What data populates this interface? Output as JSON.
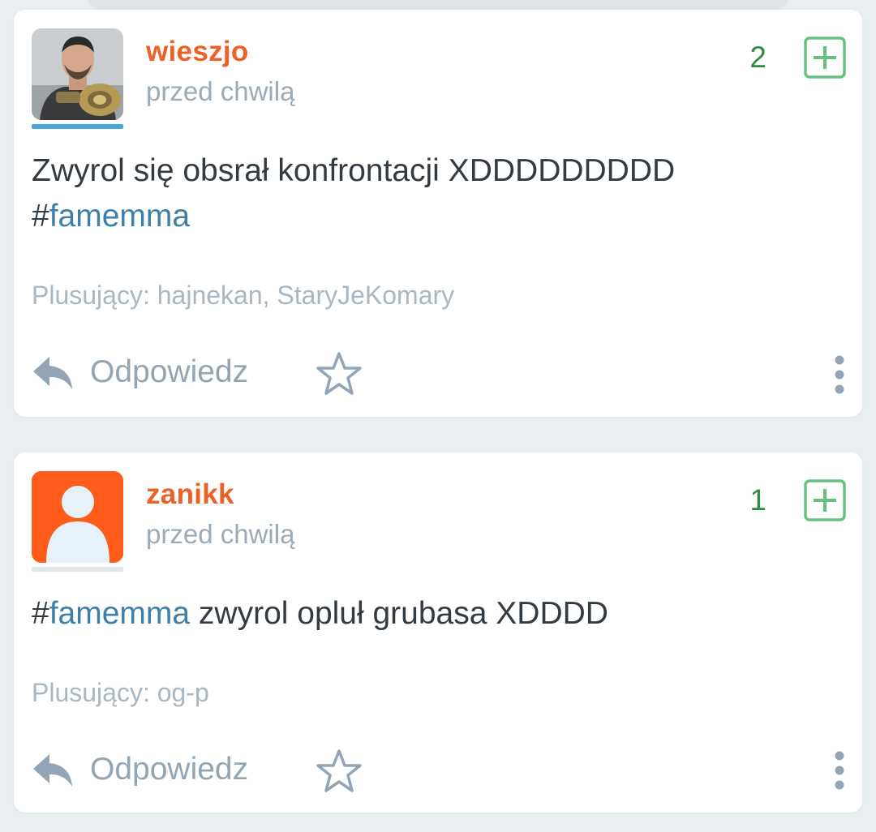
{
  "entries": [
    {
      "username": "wieszjo",
      "time": "przed chwilą",
      "votes": "2",
      "text_before": "Zwyrol się obsrał konfrontacji XDDDDDDDDD",
      "hash_sign": "#",
      "hashtag": "famemma",
      "voters": "Plusujący: hajnekan, StaryJeKomary",
      "reply_label": "Odpowiedz",
      "avatar": "user-photo",
      "underline_color": "#4aa3df"
    },
    {
      "username": "zanikk",
      "time": "przed chwilą",
      "votes": "1",
      "hash_sign": "#",
      "hashtag": "famemma",
      "text_after": " zwyrol opluł grubasa XDDDD",
      "voters": "Plusujący: og-p",
      "reply_label": "Odpowiedz",
      "avatar": "default-person-icon",
      "underline_color": "#e2e6e9"
    }
  ],
  "colors": {
    "username": "#ec6126",
    "vote": "#2f8c3f",
    "plus_border": "#66c27f",
    "hashtag": "#3d7fa6",
    "meta": "#9aaab8",
    "background": "#e9eef1"
  },
  "icons": [
    "plus-icon",
    "reply-arrow-icon",
    "star-icon",
    "more-vertical-icon"
  ]
}
